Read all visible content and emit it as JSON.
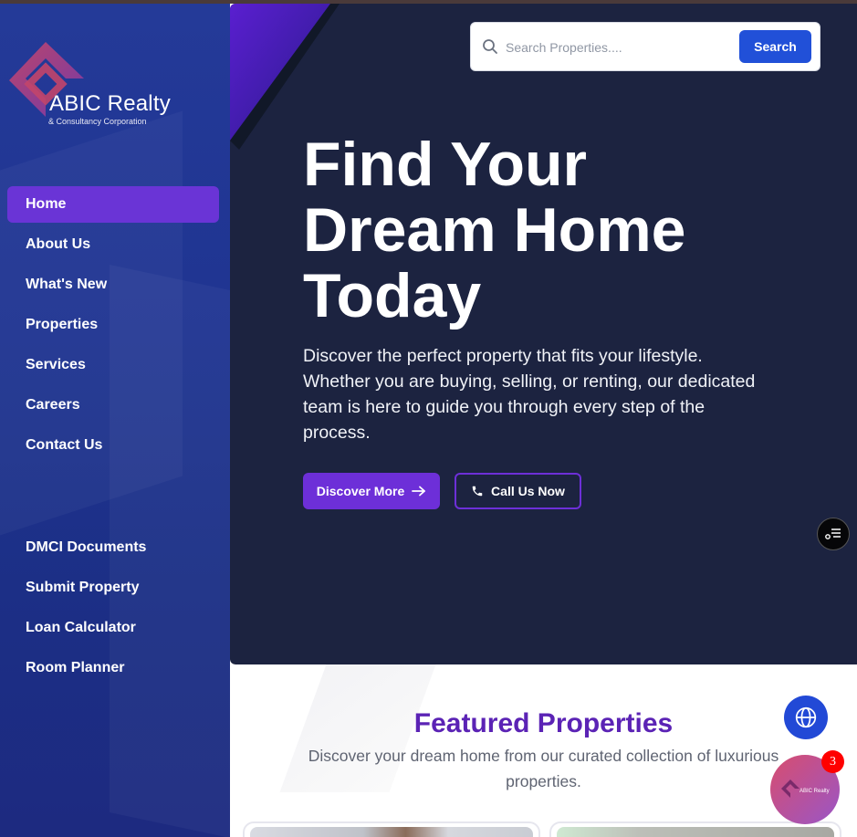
{
  "brand": {
    "name": "ABIC Realty",
    "tagline": "& Consultancy Corporation"
  },
  "sidebar": {
    "primary_items": [
      {
        "label": "Home",
        "active": true
      },
      {
        "label": "About Us"
      },
      {
        "label": "What's New"
      },
      {
        "label": "Properties"
      },
      {
        "label": "Services"
      },
      {
        "label": "Careers"
      },
      {
        "label": "Contact Us"
      }
    ],
    "secondary_items": [
      {
        "label": "DMCI Documents"
      },
      {
        "label": "Submit Property"
      },
      {
        "label": "Loan Calculator"
      },
      {
        "label": "Room Planner"
      }
    ]
  },
  "search": {
    "placeholder": "Search Properties....",
    "value": "",
    "button_label": "Search"
  },
  "hero": {
    "title": "Find Your Dream Home Today",
    "description": "Discover the perfect property that fits your lifestyle. Whether you are buying, selling, or renting, our dedicated team is here to guide you through every step of the process.",
    "primary_button": "Discover More",
    "secondary_button": "Call Us Now"
  },
  "featured": {
    "title": "Featured Properties",
    "subtitle": "Discover your dream home from our curated collection of luxurious properties."
  },
  "chat": {
    "badge_count": "3",
    "logo_text": "ABIC Realty"
  },
  "colors": {
    "sidebar_bg": "#1f3491",
    "active_nav": "#6a34d6",
    "hero_bg": "#1c2340",
    "accent_purple": "#6d2fd8",
    "search_button": "#2150d8",
    "featured_title": "#5b23b5"
  }
}
